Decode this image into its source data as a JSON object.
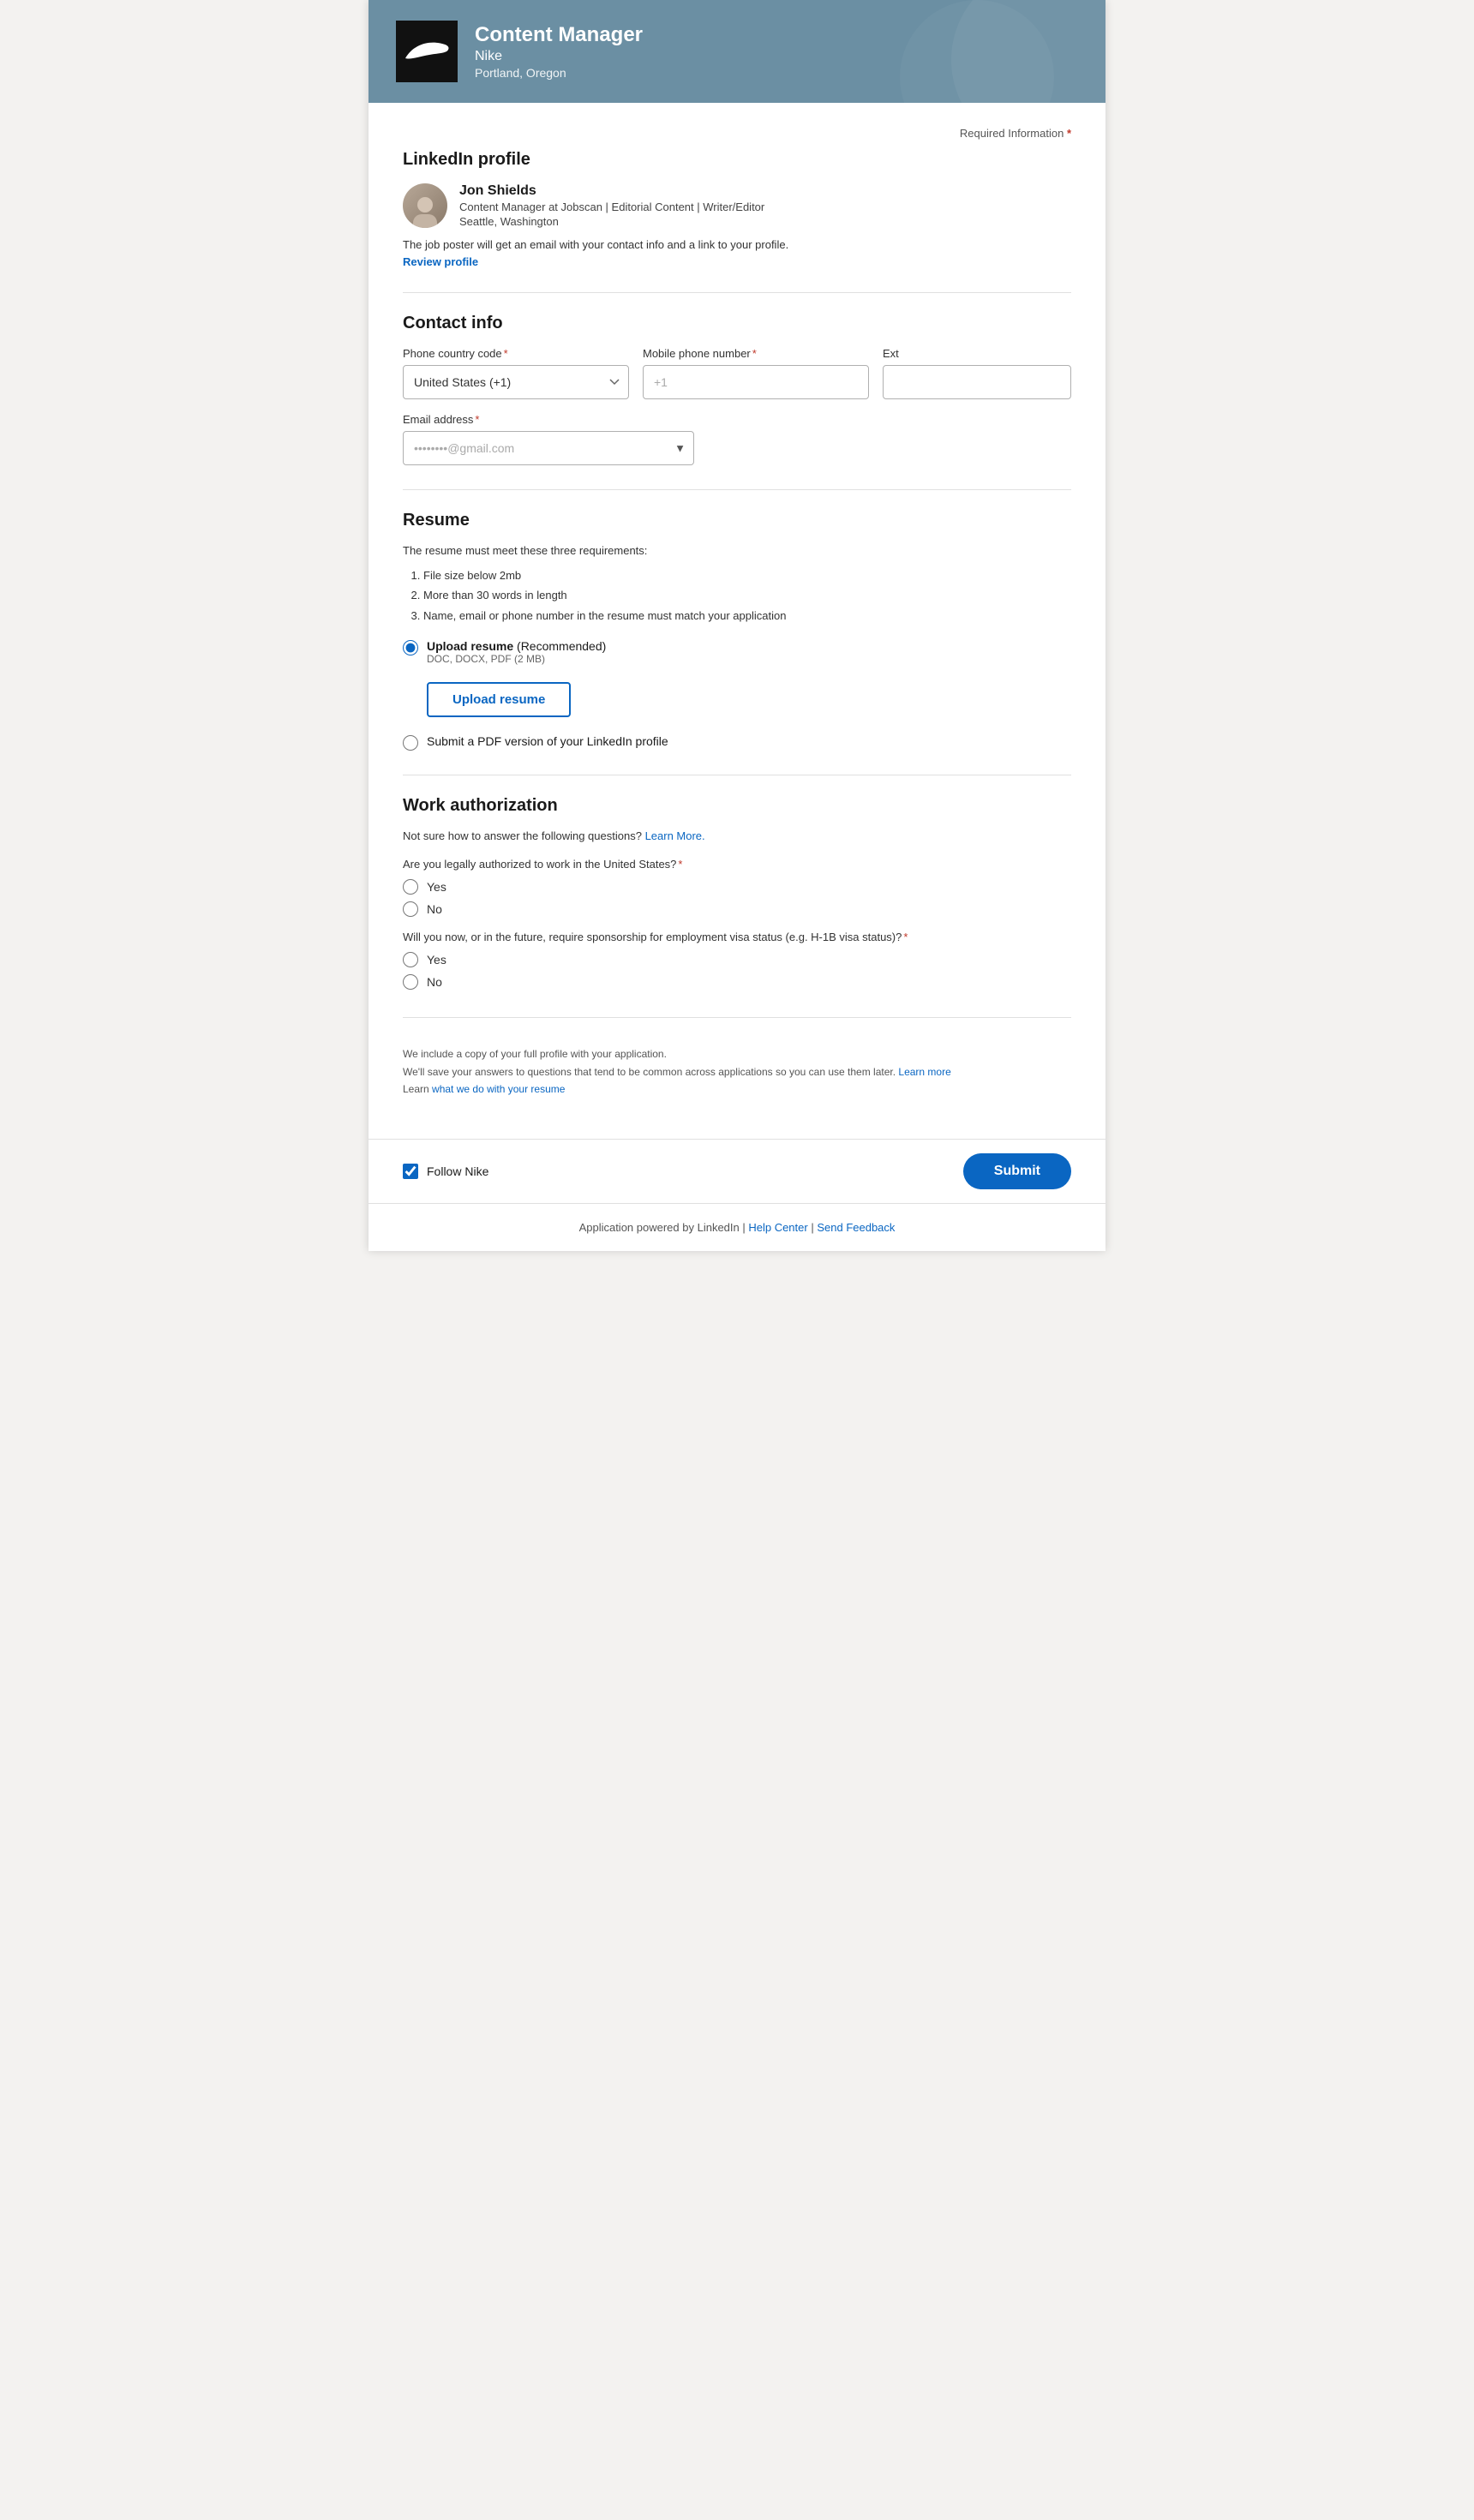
{
  "header": {
    "job_title": "Content Manager",
    "company": "Nike",
    "location": "Portland, Oregon",
    "logo_alt": "Nike logo"
  },
  "required_info": {
    "label": "Required Information",
    "star": "*"
  },
  "linkedin_section": {
    "title": "LinkedIn profile",
    "profile": {
      "name": "Jon Shields",
      "title": "Content Manager at Jobscan | Editorial Content | Writer/Editor",
      "location": "Seattle, Washington"
    },
    "notice": "The job poster will get an email with your contact info and a link to your profile.",
    "review_link": "Review profile"
  },
  "contact_section": {
    "title": "Contact info",
    "phone_country_label": "Phone country code",
    "phone_country_value": "United States (+1)",
    "phone_mobile_label": "Mobile phone number",
    "phone_mobile_placeholder": "+1",
    "ext_label": "Ext",
    "email_label": "Email address",
    "email_value": "••••••••@gmail.com",
    "email_placeholder": "••••••••@gmail.com"
  },
  "resume_section": {
    "title": "Resume",
    "requirements_intro": "The resume must meet these three requirements:",
    "requirements": [
      "File size below 2mb",
      "More than 30 words in length",
      "Name, email or phone number in the resume must match your application"
    ],
    "upload_option_label": "Upload resume",
    "upload_option_suffix": "(Recommended)",
    "upload_formats": "DOC, DOCX, PDF (2 MB)",
    "upload_btn_label": "Upload resume",
    "linkedin_pdf_label": "Submit a PDF version of your LinkedIn profile"
  },
  "work_auth_section": {
    "title": "Work authorization",
    "notice_prefix": "Not sure how to answer the following questions?",
    "learn_more_label": "Learn More.",
    "question1": "Are you legally authorized to work in the United States?",
    "question2": "Will you now, or in the future, require sponsorship for employment visa status (e.g. H-1B visa status)?",
    "yes_label": "Yes",
    "no_label": "No"
  },
  "bottom_section": {
    "line1": "We include a copy of your full profile with your application.",
    "line2_prefix": "We'll save your answers to questions that tend to be common across applications so you can use them later.",
    "learn_more_label": "Learn more",
    "line3_prefix": "Learn",
    "resume_link_label": "what we do with your resume"
  },
  "footer_bar": {
    "follow_label": "Follow Nike",
    "submit_label": "Submit"
  },
  "page_footer": {
    "text": "Application powered by LinkedIn | ",
    "help_label": "Help Center",
    "separator": " | ",
    "feedback_label": "Send Feedback"
  }
}
